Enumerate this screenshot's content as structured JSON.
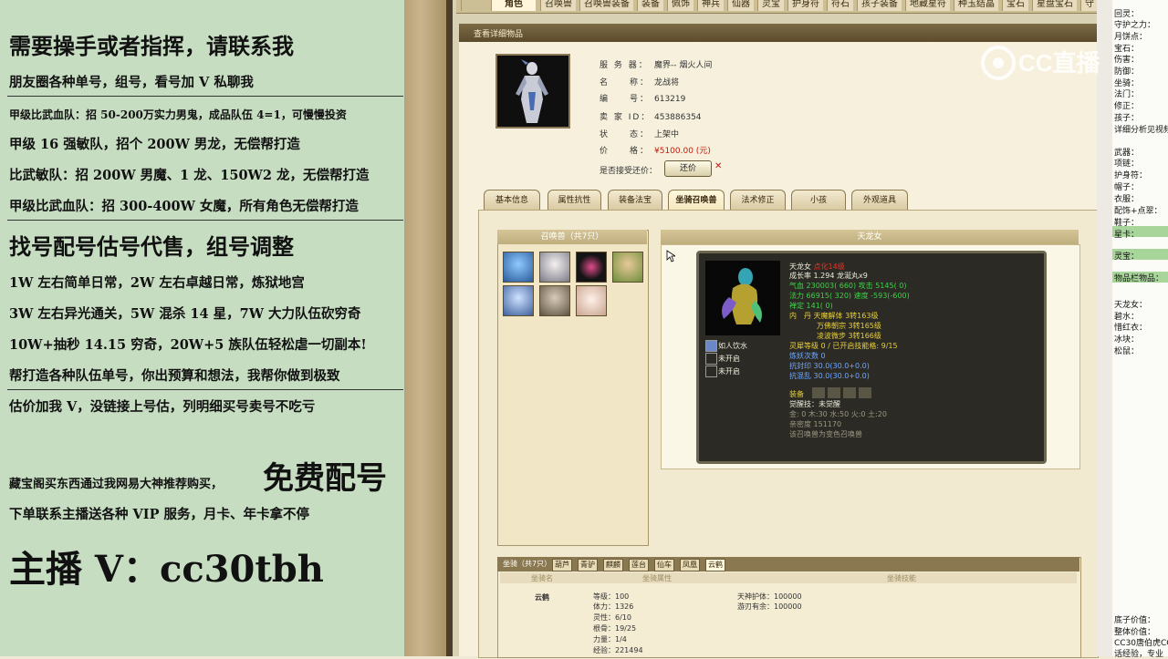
{
  "left_panel": {
    "line1": "需要操手或者指挥，请联系我",
    "line2": "朋友圈各种单号，组号，看号加 V 私聊我",
    "line3": "甲级比武血队：招 50-200万实力男鬼，成品队伍 4=1，可慢慢投资",
    "line4": "甲级 16 强敏队，招个 200W 男龙，无偿帮打造",
    "line5": "比武敏队：招 200W 男魔、1 龙、150W2 龙，无偿帮打造",
    "line6": "甲级比武血队：招 300-400W 女魔，所有角色无偿帮打造",
    "line7": "找号配号估号代售，组号调整",
    "line8": "1W 左右简单日常，2W 左右卓越日常，炼狱地宫",
    "line9": "3W 左右异光通关，5W 混杀 14 星，7W 大力队伍砍穷奇",
    "line10": "10W+抽秒 14.15 穷奇，20W+5 族队伍轻松虐一切副本!",
    "line11": "帮打造各种队伍单号，你出预算和想法，我帮你做到极致",
    "line12": "估价加我 V，没链接上号估，列明细买号卖号不吃亏",
    "line13a": "藏宝阁买东西通过我网易大神推荐购买，",
    "line13b": "免费配号",
    "line14": "下单联系主播送各种 VIP 服务，月卡、年卡拿不停",
    "line15": "主播 V：cc30tbh"
  },
  "top_tabs": [
    "角色",
    "召唤兽",
    "召唤兽装备",
    "装备",
    "佩饰",
    "神兵",
    "仙器",
    "灵宝",
    "护身符",
    "符石",
    "孩子装备",
    "地藏星符",
    "种玉结晶",
    "宝石",
    "星盘宝石",
    "守"
  ],
  "detail_bar_title": "查看详细物品",
  "info": {
    "server_label": "服 务 器：",
    "server": "魔界-- 烟火人间",
    "name_label": "名　　称：",
    "name": "龙战将",
    "id_label": "编　　号：",
    "id": "613219",
    "seller_label": "卖 家 ID：",
    "seller": "453886354",
    "status_label": "状　　态：",
    "status": "上架中",
    "price_label": "价　　格：",
    "price": "¥5100.00 (元)",
    "counter_label": "是否接受还价：",
    "counter_btn": "还价",
    "counter_x": "✕"
  },
  "detail_tabs": [
    "基本信息",
    "属性抗性",
    "装备法宝",
    "坐骑召唤兽",
    "法术修正",
    "小孩",
    "外观道具"
  ],
  "pet_list_title": "召唤兽（共7只）",
  "pet_detail_title": "天龙女",
  "pet": {
    "name": "天龙女",
    "tag": "点化14级",
    "growth": "成长率 1.294 龙涎丸x9",
    "hp": "气血 230003( 660) 攻击 5145( 0)",
    "mp": "法力 66915( 320) 速度 -593(-600)",
    "ding": "禅定 141( 0)",
    "dan1": "内　丹 天魔解体 3转163级",
    "dan2": "万佛朝宗 3转165级",
    "dan3": "凌波微步 3转166级",
    "lingshou": "灵犀等级 0 / 已开启技能格: 9/15",
    "lianyao": "炼妖次数 0",
    "kangfeng": "抗封印 30.0(30.0+0.0)",
    "kanghun": "抗混乱 30.0(30.0+0.0)",
    "equip": "装备",
    "juexing": "觉醒技：未觉醒",
    "wuxing": "金: 0 木:30 水:50 火:0 土:20",
    "qinmi": "亲密度 151170",
    "note": "该召唤兽为变色召唤兽",
    "skill1": "如人饮水",
    "skill2": "未开启",
    "skill3": "未开启"
  },
  "mount": {
    "tabs": [
      "坐骑（共7只）",
      "葫芦",
      "青驴",
      "麒麟",
      "莲台",
      "仙车",
      "凤凰",
      "云鹤"
    ],
    "head_name": "坐骑名",
    "head_attr": "坐骑属性",
    "head_skill": "坐骑技能",
    "name": "云鹤",
    "attrs": [
      "等级：100",
      "体力：1326",
      "灵性：6/10",
      "根骨：19/25",
      "力量：1/4",
      "经验：221494"
    ],
    "skills": [
      "天神护体：100000",
      "游刃有余：100000"
    ]
  },
  "right_panel": [
    "回灵：",
    "守护之力：",
    "月饼点：",
    "宝石：",
    "伤害：",
    "防御：",
    "坐骑：",
    "法门：",
    "修正：",
    "孩子：",
    "详细分析见视频",
    "武器：",
    "项链：",
    "护身符：",
    "帽子：",
    "衣服：",
    "配饰+点翠：",
    "鞋子：",
    "星卡：",
    "灵宝：",
    "物品栏物品：",
    "天龙女：",
    "碧水：",
    "惜红衣：",
    "冰块：",
    "松鼠：",
    "底子价值：",
    "整体价值：",
    "CC30唐伯虎CC",
    "话经验，专业"
  ],
  "watermark": "CC直播"
}
